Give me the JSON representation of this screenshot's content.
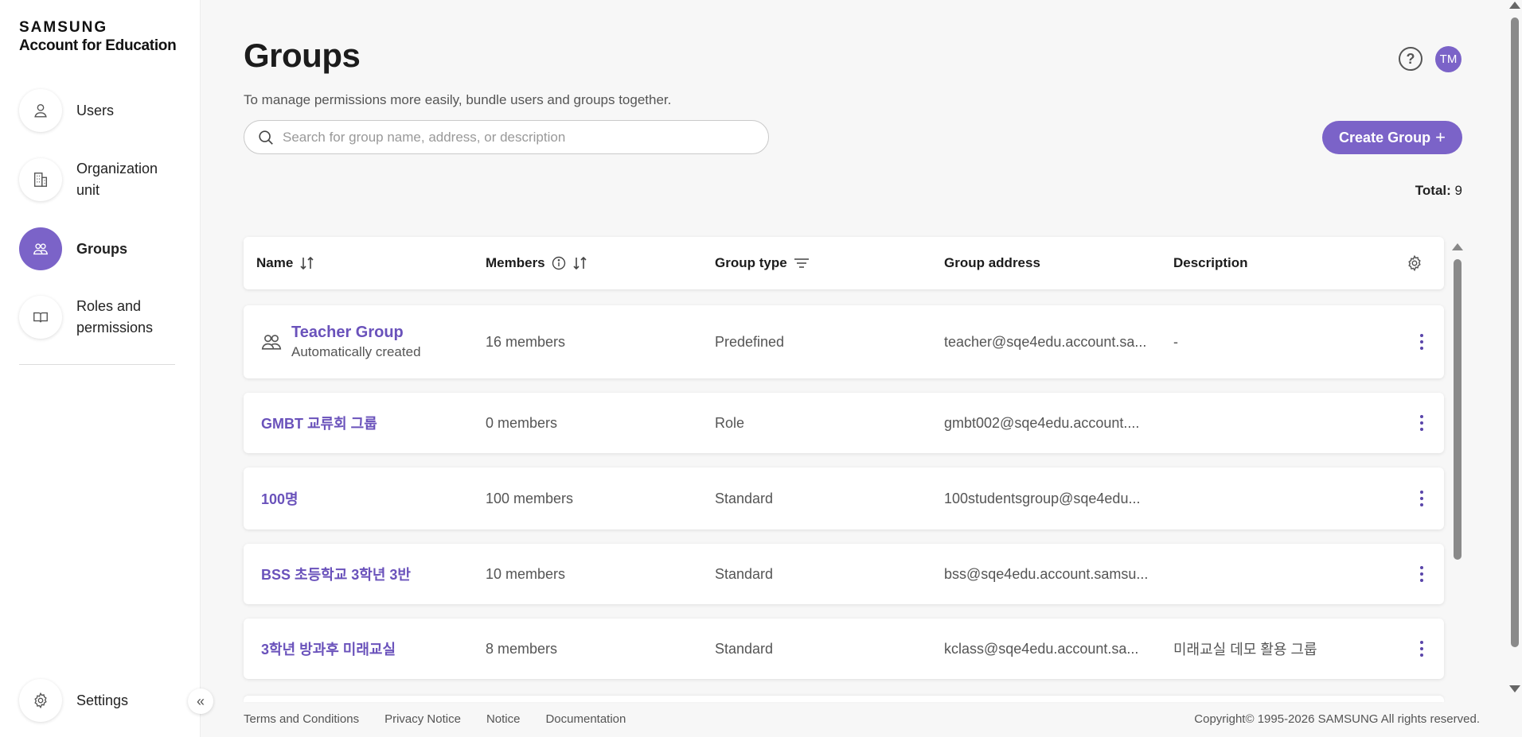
{
  "brand": {
    "line1": "SAMSUNG",
    "line2": "Account for Education"
  },
  "sidebar": {
    "items": [
      {
        "key": "users",
        "label": "Users",
        "icon": "person-icon"
      },
      {
        "key": "org",
        "label": "Organization unit",
        "icon": "building-icon"
      },
      {
        "key": "groups",
        "label": "Groups",
        "icon": "group-icon",
        "active": true
      },
      {
        "key": "roles",
        "label": "Roles and permissions",
        "icon": "book-icon"
      }
    ],
    "settings_label": "Settings",
    "collapse_glyph": "«"
  },
  "header": {
    "title": "Groups",
    "subtitle": "To manage permissions more easily, bundle users and groups together.",
    "search_placeholder": "Search for group name, address, or description",
    "help_glyph": "?",
    "avatar_initials": "TM",
    "create_label": "Create Group",
    "create_plus": "+",
    "total_label": "Total:",
    "total_value": "9"
  },
  "table": {
    "columns": {
      "name": "Name",
      "members": "Members",
      "type": "Group type",
      "address": "Group address",
      "description": "Description"
    },
    "rows": [
      {
        "name": "Teacher Group",
        "sub": "Automatically created",
        "members": "16 members",
        "type": "Predefined",
        "address": "teacher@sqe4edu.account.sa...",
        "description": "-"
      },
      {
        "name": "GMBT 교류회 그룹",
        "members": "0 members",
        "type": "Role",
        "address": "gmbt002@sqe4edu.account....",
        "description": ""
      },
      {
        "name": "100명",
        "members": "100 members",
        "type": "Standard",
        "address": "100studentsgroup@sqe4edu...",
        "description": ""
      },
      {
        "name": "BSS 초등학교 3학년 3반",
        "members": "10 members",
        "type": "Standard",
        "address": "bss@sqe4edu.account.samsu...",
        "description": ""
      },
      {
        "name": "3학년 방과후 미래교실",
        "members": "8 members",
        "type": "Standard",
        "address": "kclass@sqe4edu.account.sa...",
        "description": "미래교실 데모 활용 그룹"
      }
    ]
  },
  "footer": {
    "links": [
      "Terms and Conditions",
      "Privacy Notice",
      "Notice",
      "Documentation"
    ],
    "copyright": "Copyright© 1995-2026 SAMSUNG All rights reserved."
  },
  "colors": {
    "accent": "#7b63c8",
    "link": "#6a52bb"
  }
}
